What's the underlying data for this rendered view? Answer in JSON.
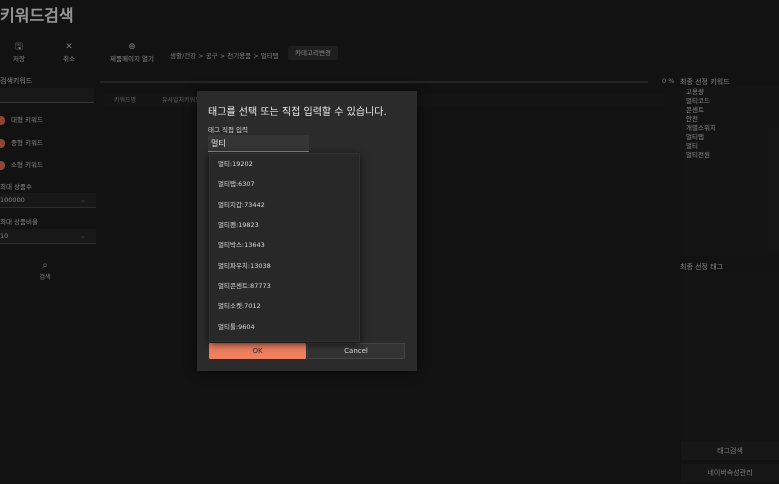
{
  "app": {
    "title": "키워드검색"
  },
  "toolbar": [
    {
      "icon": "save-icon",
      "glyph": "🖫",
      "label": "저장"
    },
    {
      "icon": "close-icon",
      "glyph": "✕",
      "label": "취소"
    },
    {
      "icon": "globe-icon",
      "glyph": "⊕",
      "label": "제품페이지 열기"
    }
  ],
  "breadcrumb": "생활/건강 > 공구 > 전기용품 > 멀티탭",
  "category_change_label": "카테고리변경",
  "progress": {
    "percent_text": "0 %",
    "value": 0
  },
  "left": {
    "title": "검색키워드",
    "keywords": [
      "대형 키워드",
      "중형 키워드",
      "소형 키워드"
    ],
    "max_products_label": "최대 상품수",
    "max_products_value": "100000",
    "max_ratio_label": "최대 상품비율",
    "max_ratio_value": "10",
    "search_label": "검색"
  },
  "table": {
    "headers": [
      "키워드명",
      "유사일치키워드"
    ]
  },
  "right": {
    "final_keywords_title": "최종 선정 키워드",
    "final_keywords": [
      "고용량",
      "멀티코드",
      "콘센트",
      "안전",
      "개별스위치",
      "멀티탭",
      "멀티",
      "멀티전원"
    ],
    "final_tags_title": "최종 선정 태그",
    "tag_search_label": "태그검색",
    "naver_attr_label": "네이버속성관리"
  },
  "dialog": {
    "title": "태그를 선택 또는 직접 입력할 수 있습니다.",
    "input_label": "태그 직접 입력",
    "input_value": "멀티",
    "ok_label": "OK",
    "cancel_label": "Cancel"
  },
  "suggestions": [
    "멀티:19202",
    "멀티탭:6307",
    "멀티지갑:73442",
    "멀티펜:19823",
    "멀티박스:13643",
    "멀티파우치:13038",
    "멀티콘센트:87773",
    "멀티소켓:7012",
    "멀티툴:9604"
  ],
  "colors": {
    "accent": "#f08060",
    "background": "#1c1c1c",
    "dialog": "#2b2b2b"
  }
}
